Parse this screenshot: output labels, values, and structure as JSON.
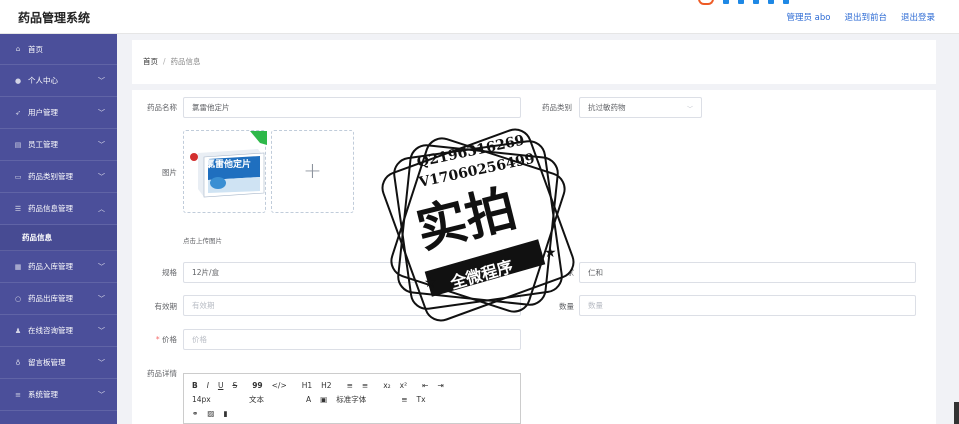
{
  "header": {
    "app_title": "药品管理系统",
    "user_label": "管理员 abo",
    "back_label": "退出到前台",
    "logout_label": "退出登录"
  },
  "sidebar": {
    "items": [
      {
        "label": "首页",
        "icon": "home-icon"
      },
      {
        "label": "个人中心",
        "icon": "user-icon"
      },
      {
        "label": "用户管理",
        "icon": "send-icon"
      },
      {
        "label": "员工管理",
        "icon": "briefcase-icon"
      },
      {
        "label": "药品类别管理",
        "icon": "card-icon"
      },
      {
        "label": "药品信息管理",
        "icon": "list-icon"
      },
      {
        "label": "药品入库管理",
        "icon": "grid-icon"
      },
      {
        "label": "药品出库管理",
        "icon": "circle-icon"
      },
      {
        "label": "在线咨询管理",
        "icon": "person-icon"
      },
      {
        "label": "留言板管理",
        "icon": "bulb-icon"
      },
      {
        "label": "系统管理",
        "icon": "menu-icon"
      }
    ],
    "sub_item": "药品信息"
  },
  "breadcrumb": {
    "home": "首页",
    "current": "药品信息",
    "separator": "/"
  },
  "form": {
    "name_label": "药品名称",
    "name_value": "氯雷他定片",
    "category_label": "药品类别",
    "category_value": "抗过敏药物",
    "image_label": "图片",
    "upload_hint": "点击上传图片",
    "spec_label": "规格",
    "spec_value": "12片/盒",
    "maker_label": "厂家",
    "maker_value": "仁和",
    "expiry_label": "有效期",
    "expiry_placeholder": "有效期",
    "qty_label": "数量",
    "qty_placeholder": "数量",
    "price_label": "价格",
    "price_placeholder": "价格",
    "detail_label": "药品详情",
    "required_mark": "*"
  },
  "product_box": {
    "text": "氯雷他定片"
  },
  "editor": {
    "row1": [
      "B",
      "I",
      "U",
      "S",
      "99",
      "</>",
      "H1",
      "H2",
      "≡",
      "≡",
      "x₂",
      "x²",
      "⇤",
      "⇥"
    ],
    "font_size": "14px",
    "font_type": "文本",
    "font_family": "标准字体"
  },
  "watermark": {
    "line1": "Q2196316269",
    "line2": "V17060256499",
    "main": "实拍",
    "banner": "全微程序"
  },
  "colors": {
    "sidebar": "#4b4f9a",
    "link": "#2d6bd4",
    "accent": "#ee5a24"
  }
}
